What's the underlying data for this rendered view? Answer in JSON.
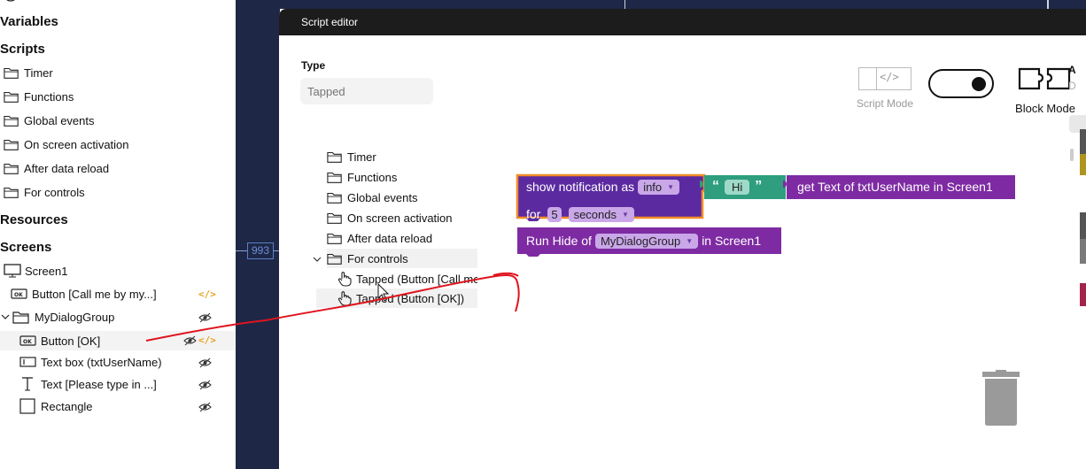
{
  "left_panel": {
    "sections": {
      "variables": "Variables",
      "scripts": "Scripts",
      "resources": "Resources",
      "screens": "Screens"
    },
    "script_folders": [
      "Timer",
      "Functions",
      "Global events",
      "On screen activation",
      "After data reload",
      "For controls"
    ],
    "screen_tree": {
      "screen": "Screen1",
      "button_call": "Button [Call me by my...]",
      "group": "MyDialogGroup",
      "button_ok": "Button [OK]",
      "textbox": "Text box  (txtUserName)",
      "text": "Text [Please type in ...]",
      "rectangle": "Rectangle"
    }
  },
  "canvas": {
    "ruler_value": "993"
  },
  "editor": {
    "title": "Script editor",
    "type_label": "Type",
    "type_placeholder": "Tapped",
    "script_mode_label": "Script Mode",
    "block_mode_label": "Block Mode",
    "tree_folders": [
      "Timer",
      "Functions",
      "Global events",
      "On screen activation",
      "After data reload",
      "For controls"
    ],
    "tree_events": [
      "Tapped (Button [Call me",
      "Tapped (Button [OK])"
    ],
    "blocks": {
      "notify_prefix": "show notification as",
      "notify_type": "info",
      "string_value": "Hi",
      "get_text": "get Text of txtUserName in Screen1",
      "for_label": "for",
      "duration_value": "5",
      "duration_unit": "seconds",
      "run_prefix": "Run Hide of",
      "run_target": "MyDialogGroup",
      "run_suffix": "in Screen1"
    }
  },
  "colors": {
    "accent_orange": "#f28c28",
    "block_purple": "#5b2aa0",
    "block_magenta": "#7e2ba3",
    "string_green": "#2e9e7e",
    "dark_bg": "#1e2746",
    "annotation_red": "#e0141e"
  }
}
